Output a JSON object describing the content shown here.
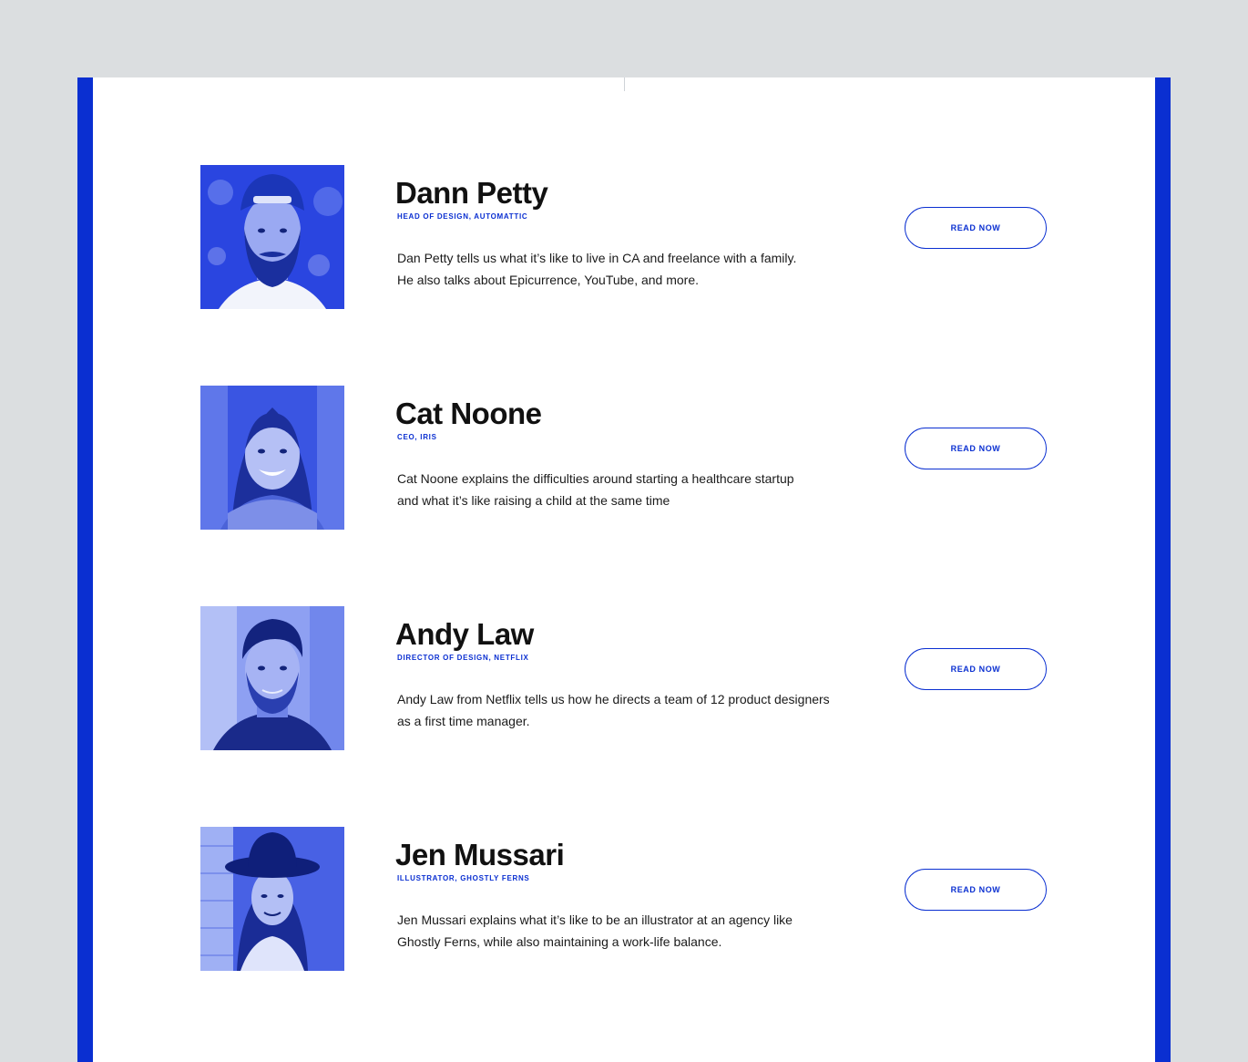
{
  "theme": {
    "accent": "#0a2fd1",
    "page_background": "#dbdee0",
    "panel_background": "#ffffff",
    "text_color": "#111111"
  },
  "people": [
    {
      "name": "Dann Petty",
      "role": "HEAD OF DESIGN, AUTOMATTIC",
      "description_lines": [
        "Dan Petty tells us what it’s like to live in CA and freelance with a family.",
        "He also talks about Epicurrence, YouTube, and more."
      ],
      "button_label": "READ NOW",
      "photo_icon": "portrait-man-cap-beard-icon"
    },
    {
      "name": "Cat Noone",
      "role": "CEO, IRIS",
      "description_lines": [
        "Cat Noone explains the difficulties around starting a healthcare startup",
        "and what it’s like raising a child at the same time"
      ],
      "button_label": "READ NOW",
      "photo_icon": "portrait-woman-smiling-icon"
    },
    {
      "name": "Andy Law",
      "role": "DIRECTOR OF DESIGN, NETFLIX",
      "description_lines": [
        "Andy Law from Netflix tells us how he directs a team of 12 product designers",
        "as a first time manager."
      ],
      "button_label": "READ NOW",
      "photo_icon": "portrait-man-beard-icon"
    },
    {
      "name": "Jen Mussari",
      "role": "ILLUSTRATOR, GHOSTLY FERNS",
      "description_lines": [
        "Jen Mussari explains what it’s like to be an illustrator at an agency like",
        "Ghostly Ferns, while also maintaining a work-life balance."
      ],
      "button_label": "READ NOW",
      "photo_icon": "portrait-woman-hat-icon"
    }
  ]
}
